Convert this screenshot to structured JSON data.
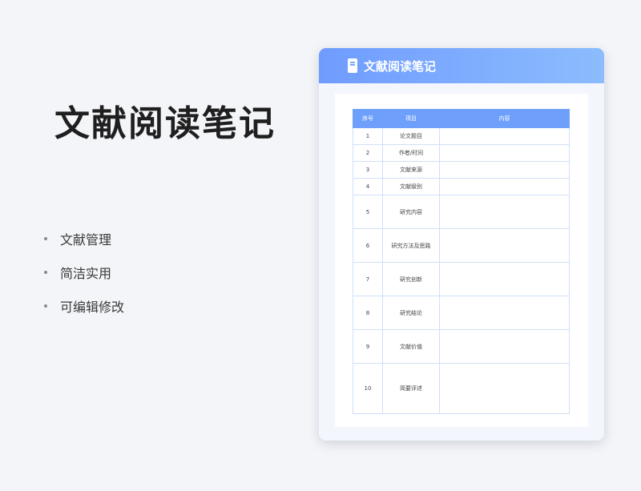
{
  "main_title": "文献阅读笔记",
  "features": [
    "文献管理",
    "简洁实用",
    "可编辑修改"
  ],
  "card": {
    "title": "文献阅读笔记",
    "icon": "document-icon",
    "header_colors": [
      "#6f9cff",
      "#8cbcfd"
    ]
  },
  "table": {
    "headers": [
      "序号",
      "项目",
      "内容"
    ],
    "rows": [
      {
        "no": "1",
        "item": "论文题目",
        "content": ""
      },
      {
        "no": "2",
        "item": "作者/时间",
        "content": ""
      },
      {
        "no": "3",
        "item": "文献来源",
        "content": ""
      },
      {
        "no": "4",
        "item": "文献级别",
        "content": ""
      },
      {
        "no": "5",
        "item": "研究内容",
        "content": ""
      },
      {
        "no": "6",
        "item": "研究方法及思路",
        "content": ""
      },
      {
        "no": "7",
        "item": "研究创新",
        "content": ""
      },
      {
        "no": "8",
        "item": "研究结论",
        "content": ""
      },
      {
        "no": "9",
        "item": "文献价值",
        "content": ""
      },
      {
        "no": "10",
        "item": "简要评述",
        "content": ""
      }
    ]
  }
}
